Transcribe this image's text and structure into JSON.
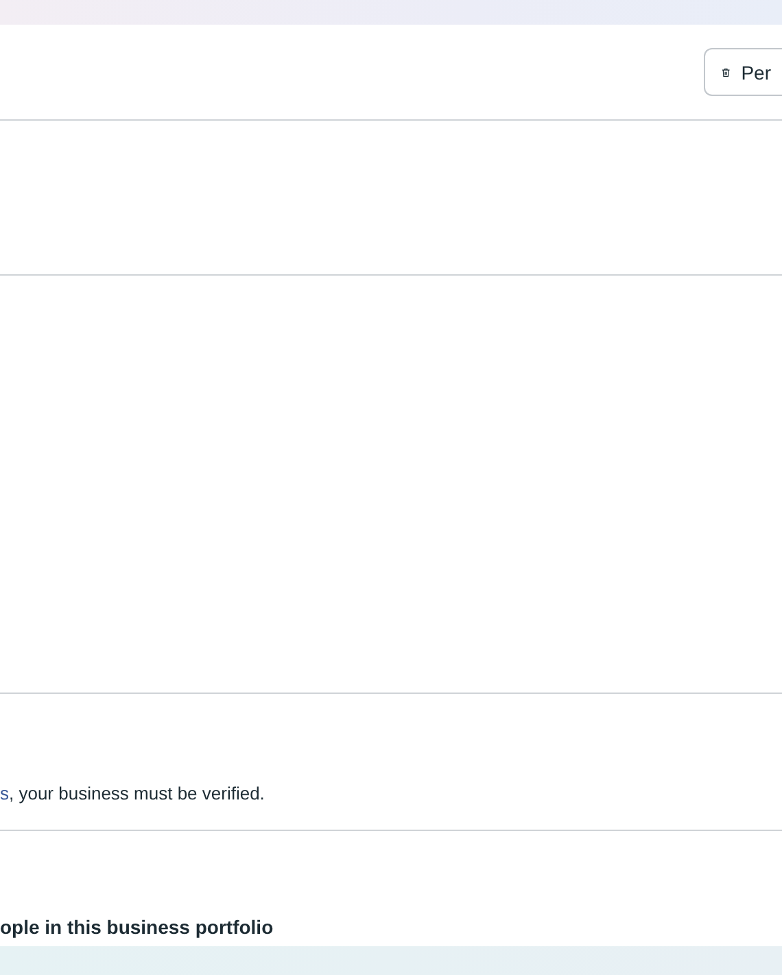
{
  "header": {
    "button": {
      "label": "Per"
    }
  },
  "verification_note": {
    "link": "s",
    "text": ", your business must be verified."
  },
  "people_section": {
    "title": "ople in this business portfolio"
  }
}
